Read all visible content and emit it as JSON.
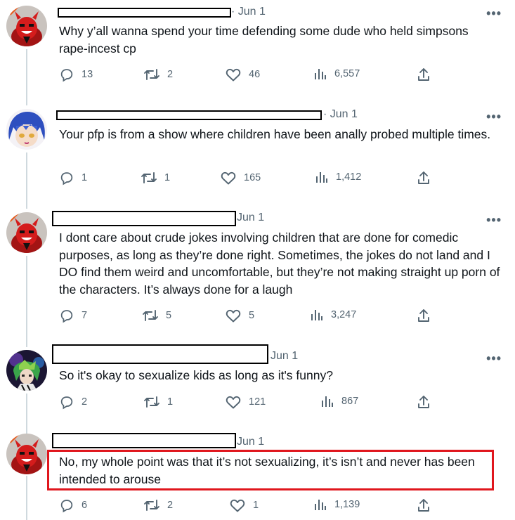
{
  "tweets": [
    {
      "date": "Jun 1",
      "text": "Why y’all wanna spend your time defending some dude who held simpsons rape-incest cp",
      "replies": "13",
      "retweets": "2",
      "likes": "46",
      "views": "6,557"
    },
    {
      "date": "Jun 1",
      "text": "Your pfp is from a show where children have been anally probed multiple times.",
      "replies": "1",
      "retweets": "1",
      "likes": "165",
      "views": "1,412"
    },
    {
      "date": "Jun 1",
      "text": "I dont care about crude jokes involving children that are done for comedic purposes, as long as they’re done right. Sometimes, the jokes do not land and I DO find them weird and uncomfortable, but they’re not making straight up porn of the characters. It’s always done for a laugh",
      "replies": "7",
      "retweets": "5",
      "likes": "5",
      "views": "3,247"
    },
    {
      "date": "Jun 1",
      "text": "So it's okay to sexualize kids as long as it's funny?",
      "replies": "2",
      "retweets": "1",
      "likes": "121",
      "views": "867"
    },
    {
      "date": "Jun 1",
      "text": "No, my whole point was that it’s not sexualizing, it’s isn’t and never has been intended to arouse",
      "replies": "6",
      "retweets": "2",
      "likes": "1",
      "views": "1,139"
    }
  ],
  "colors": {
    "text": "#0f1419",
    "muted": "#536471",
    "thread_line": "#cfd9de",
    "highlight_box": "#e0161d",
    "redaction": "#000000"
  },
  "icons": [
    "reply-icon",
    "retweet-icon",
    "like-icon",
    "views-icon",
    "share-icon",
    "more-icon"
  ]
}
